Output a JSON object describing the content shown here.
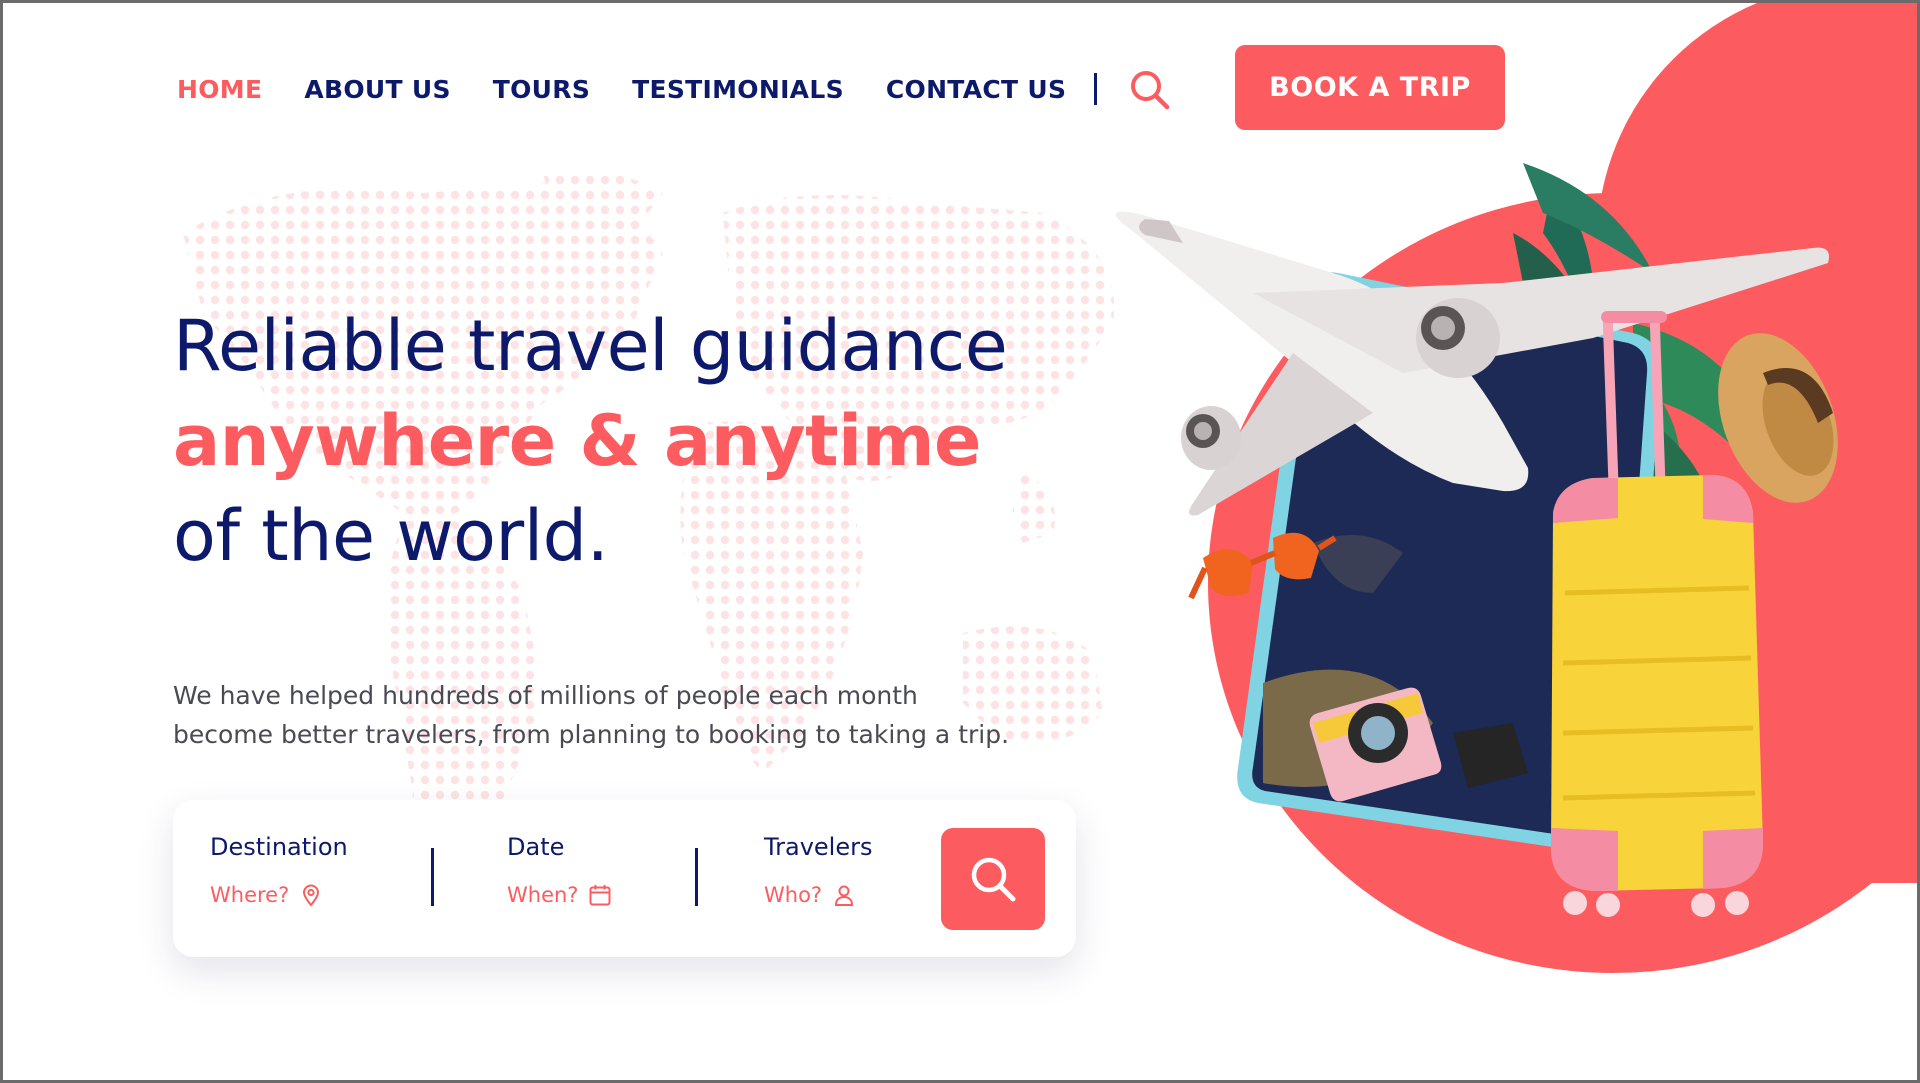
{
  "colors": {
    "accent": "#fc5c5f",
    "navy": "#0d1a6b",
    "body_text": "#4a4a55",
    "suitcase": "#f8d33a"
  },
  "nav": {
    "items": [
      {
        "label": "HOME",
        "active": true
      },
      {
        "label": "ABOUT US",
        "active": false
      },
      {
        "label": "TOURS",
        "active": false
      },
      {
        "label": "TESTIMONIALS",
        "active": false
      },
      {
        "label": "CONTACT US",
        "active": false
      }
    ],
    "search_icon": "search-icon",
    "cta_label": "BOOK A TRIP"
  },
  "hero": {
    "line1": "Reliable travel guidance",
    "line2": "anywhere & anytime",
    "line3": "of the world.",
    "subtitle_line1": "We have helped hundreds of millions of people each month",
    "subtitle_line2": "become better travelers, from planning to booking to taking a trip."
  },
  "search_card": {
    "fields": [
      {
        "label": "Destination",
        "placeholder": "Where?",
        "icon": "map-pin-icon"
      },
      {
        "label": "Date",
        "placeholder": "When?",
        "icon": "calendar-icon"
      },
      {
        "label": "Travelers",
        "placeholder": "Who?",
        "icon": "user-icon"
      }
    ],
    "button_icon": "search-icon"
  },
  "illustration": {
    "items": [
      "airplane",
      "smartphone",
      "suitcase",
      "sunglasses",
      "camera",
      "straw-hat",
      "palm-leaves"
    ]
  }
}
